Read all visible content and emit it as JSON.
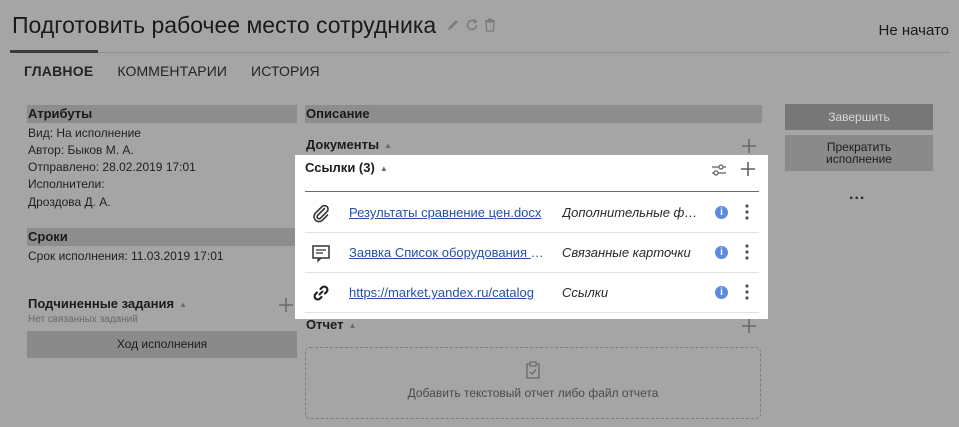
{
  "header": {
    "title": "Подготовить рабочее место сотрудника",
    "status": "Не начато"
  },
  "tabs": [
    {
      "label": "ГЛАВНОЕ"
    },
    {
      "label": "КОММЕНТАРИИ"
    },
    {
      "label": "ИСТОРИЯ"
    }
  ],
  "attributes": {
    "heading": "Атрибуты",
    "lines": [
      "Вид: На исполнение",
      "Автор: Быков М. А.",
      "Отправлено: 28.02.2019 17:01",
      "Исполнители:",
      "Дроздова Д. А."
    ]
  },
  "deadlines": {
    "heading": "Сроки",
    "due": "Срок исполнения: 11.03.2019 17:01"
  },
  "subtasks": {
    "heading": "Подчиненные задания",
    "empty": "Нет связанных заданий",
    "progress_button": "Ход исполнения"
  },
  "description": {
    "heading": "Описание"
  },
  "documents": {
    "heading": "Документы"
  },
  "links": {
    "heading": "Ссылки (3)",
    "items": [
      {
        "icon": "paperclip-icon",
        "name": "Результаты сравнение цен.docx",
        "type": "Дополнительные файлы"
      },
      {
        "icon": "card-icon",
        "name": "Заявка Список оборудования для сотрудника",
        "type": "Связанные карточки"
      },
      {
        "icon": "link-icon",
        "name": "https://market.yandex.ru/catalog",
        "type": "Ссылки"
      }
    ]
  },
  "report": {
    "heading": "Отчет",
    "dropzone": "Добавить текстовый отчет либо файл отчета"
  },
  "actions": {
    "complete": "Завершить",
    "stop": "Прекратить исполнение",
    "more": "..."
  },
  "colors": {
    "link": "#2451a8",
    "info": "#5c8ddb",
    "overlay": "#a5a5a5"
  }
}
